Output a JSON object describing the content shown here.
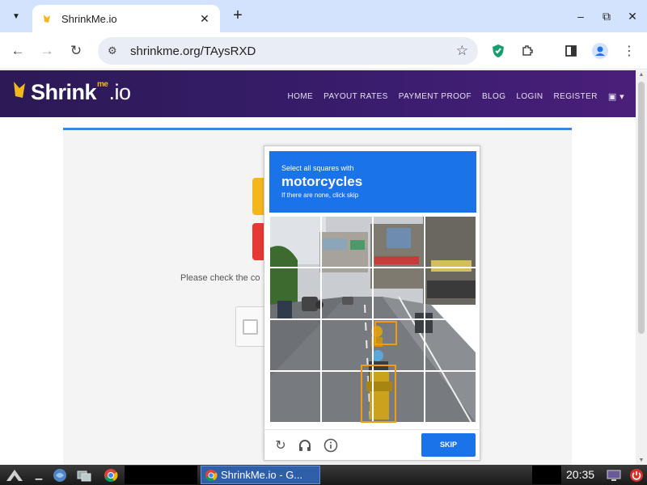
{
  "browser": {
    "tab_title": "ShrinkMe.io",
    "url": "shrinkme.org/TAysRXD"
  },
  "site": {
    "logo_main": "Shrink",
    "logo_me": "me",
    "logo_io": ".io",
    "nav": [
      "HOME",
      "PAYOUT RATES",
      "PAYMENT PROOF",
      "BLOG",
      "LOGIN",
      "REGISTER"
    ],
    "please_check": "Please check the co"
  },
  "captcha": {
    "instruction": "Select all squares with",
    "target": "motorcycles",
    "hint": "If there are none, click skip",
    "skip_label": "SKIP"
  },
  "taskbar": {
    "active_window": "ShrinkMe.io - G...",
    "clock": "20:35"
  },
  "colors": {
    "captcha_blue": "#1a73e8",
    "selection_orange": "#f39c12",
    "site_header": "#3a1d6e",
    "brand_yellow": "#f3b71b"
  }
}
